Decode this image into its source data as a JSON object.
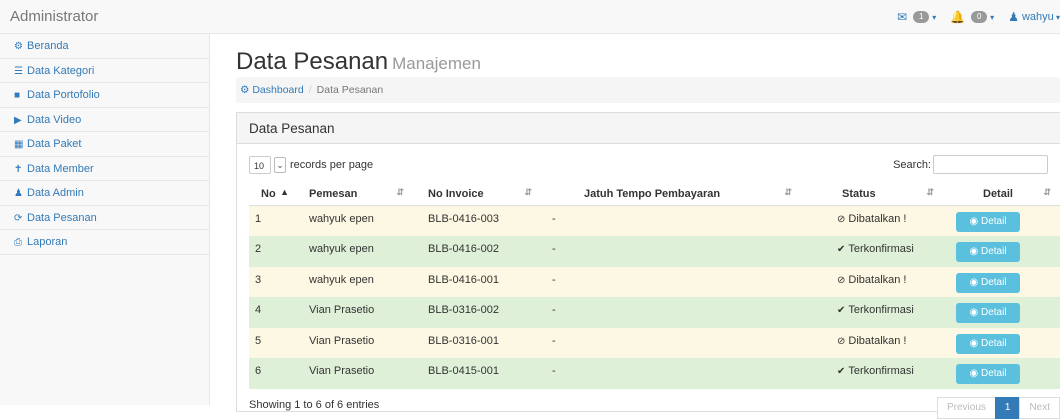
{
  "header": {
    "brand": "Administrator",
    "messages_count": "1",
    "alerts_count": "0",
    "user_name": "wahyu"
  },
  "sidebar": {
    "items": [
      {
        "label": "Beranda",
        "icon": "dashboard-icon"
      },
      {
        "label": "Data Kategori",
        "icon": "list-icon"
      },
      {
        "label": "Data Portofolio",
        "icon": "portfolio-icon"
      },
      {
        "label": "Data Video",
        "icon": "play-icon"
      },
      {
        "label": "Data Paket",
        "icon": "grid-icon"
      },
      {
        "label": "Data Member",
        "icon": "member-icon"
      },
      {
        "label": "Data Admin",
        "icon": "users-icon"
      },
      {
        "label": "Data Pesanan",
        "icon": "refresh-icon"
      },
      {
        "label": "Laporan",
        "icon": "print-icon"
      }
    ]
  },
  "page": {
    "title": "Data Pesanan",
    "subtitle": "Manajemen",
    "breadcrumb_home": "Dashboard",
    "breadcrumb_current": "Data Pesanan"
  },
  "panel": {
    "heading": "Data Pesanan",
    "length_value": "10",
    "length_label": "records per page",
    "search_label": "Search:",
    "info": "Showing 1 to 6 of 6 entries",
    "pager": {
      "prev": "Previous",
      "page": "1",
      "next": "Next"
    }
  },
  "table": {
    "headers": [
      "No",
      "Pemesan",
      "No Invoice",
      "Jatuh Tempo Pembayaran",
      "Status",
      "Detail"
    ],
    "detail_label": "Detail",
    "rows": [
      {
        "no": "1",
        "pemesan": "wahyuk epen",
        "invoice": "BLB-0416-003",
        "jatuh_tempo": "-",
        "status": "Dibatalkan !",
        "state": "cancelled"
      },
      {
        "no": "2",
        "pemesan": "wahyuk epen",
        "invoice": "BLB-0416-002",
        "jatuh_tempo": "-",
        "status": "Terkonfirmasi",
        "state": "confirmed"
      },
      {
        "no": "3",
        "pemesan": "wahyuk epen",
        "invoice": "BLB-0416-001",
        "jatuh_tempo": "-",
        "status": "Dibatalkan !",
        "state": "cancelled"
      },
      {
        "no": "4",
        "pemesan": "Vian Prasetio",
        "invoice": "BLB-0316-002",
        "jatuh_tempo": "-",
        "status": "Terkonfirmasi",
        "state": "confirmed"
      },
      {
        "no": "5",
        "pemesan": "Vian Prasetio",
        "invoice": "BLB-0316-001",
        "jatuh_tempo": "-",
        "status": "Dibatalkan !",
        "state": "cancelled"
      },
      {
        "no": "6",
        "pemesan": "Vian Prasetio",
        "invoice": "BLB-0415-001",
        "jatuh_tempo": "-",
        "status": "Terkonfirmasi",
        "state": "confirmed"
      }
    ]
  },
  "colors": {
    "link": "#337ab7",
    "row_warning": "#fcf8e3",
    "row_success": "#dff0d8",
    "detail_button": "#5bc0de"
  }
}
